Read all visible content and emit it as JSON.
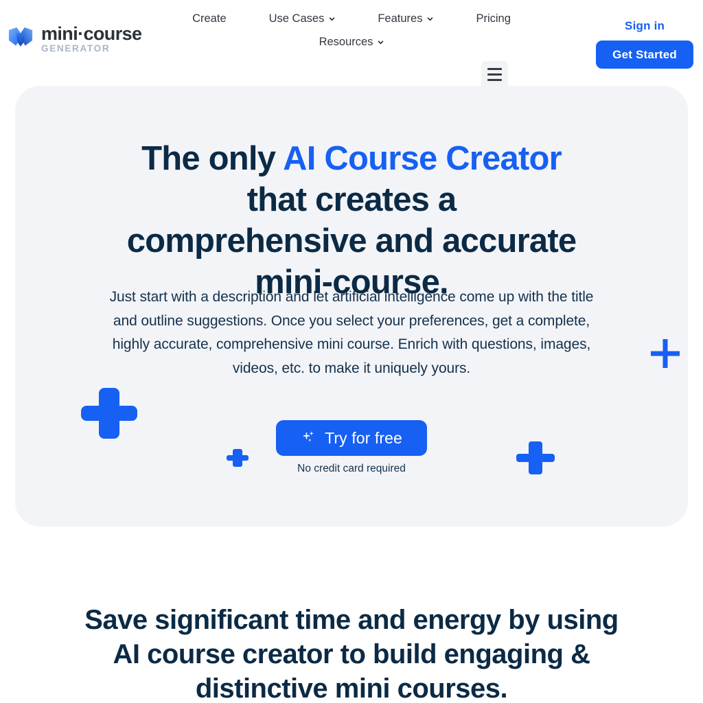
{
  "brand": {
    "name": "mini·course",
    "subtitle": "GENERATOR",
    "logo_icon": "minicourse-logo-icon"
  },
  "nav": {
    "row1": [
      {
        "label": "Create",
        "has_chevron": false
      },
      {
        "label": "Use Cases",
        "has_chevron": true
      },
      {
        "label": "Features",
        "has_chevron": true
      },
      {
        "label": "Pricing",
        "has_chevron": false
      }
    ],
    "row2": [
      {
        "label": "Resources",
        "has_chevron": true
      }
    ],
    "menu_icon": "hamburger-menu-icon"
  },
  "header_actions": {
    "signin_label": "Sign in",
    "get_started_label": "Get Started"
  },
  "hero": {
    "headline_part1": "The only ",
    "headline_accent": "AI Course Creator",
    "headline_part2": " that creates a comprehensive and accurate mini-course.",
    "subcopy": "Just start with a description and let artificial intelligence come up with the title and outline suggestions. Once you select your preferences, get a complete, highly accurate, comprehensive mini course. Enrich with questions, images, videos, etc. to make it uniquely yours.",
    "cta_label": "Try for free",
    "cta_icon": "sparkle-plus-icon",
    "cta_note": "No credit card required",
    "decorations": [
      "plus-decoration-large-left",
      "plus-decoration-thin-right",
      "plus-decoration-small-center",
      "plus-decoration-medium-right"
    ]
  },
  "section_two": {
    "title": "Save significant time and energy by using AI course creator to build engaging & distinctive mini courses."
  },
  "colors": {
    "accent_blue": "#1660f3",
    "headline_navy": "#0b2a45",
    "card_background": "#f3f4f7",
    "page_background": "#ffffff",
    "brand_text": "#2b3138",
    "brand_subtitle": "#a9b4c4",
    "nav_text": "#32383f"
  }
}
